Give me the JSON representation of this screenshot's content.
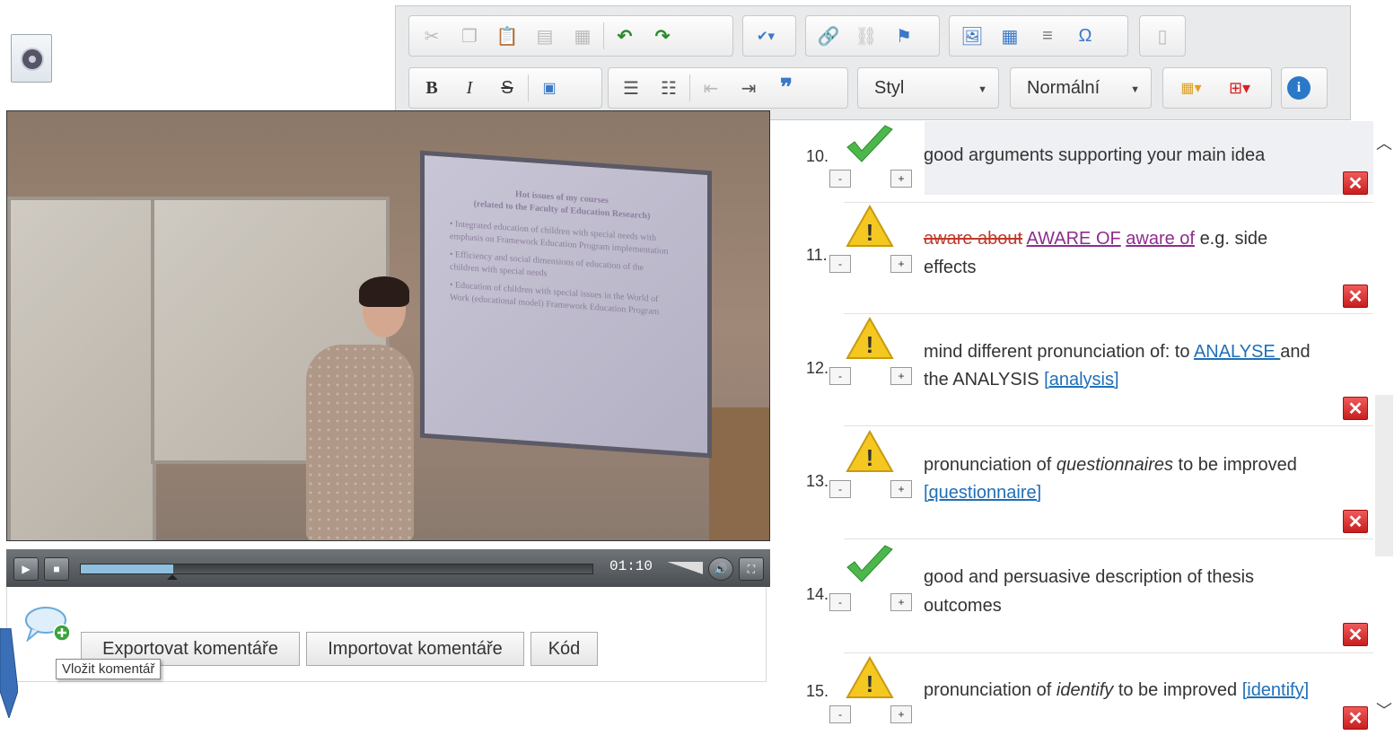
{
  "toolbar": {
    "row1": [
      "cut-icon",
      "copy-icon",
      "paste-icon",
      "paste-text-icon",
      "paste-word-icon",
      "undo-icon",
      "redo-icon",
      "spellcheck-icon",
      "link-icon",
      "unlink-icon",
      "anchor-icon",
      "image-icon",
      "table-icon",
      "horizontal-rule-icon",
      "special-char-icon",
      "page-icon"
    ],
    "bold": "B",
    "italic": "I",
    "strike": "S",
    "style_label": "Styl",
    "format_label": "Normální"
  },
  "video": {
    "time": "01:10",
    "progress": 0.18,
    "slide_lines": [
      "Hot issues of my courses",
      "(related to the Faculty of Education Research)",
      "• Integrated education of children with special needs with emphasis on Framework Education Program implementation",
      "• Efficiency and social dimensions of education of the children with special needs",
      "• Education of children with special issues in the World of Work (educational model) Framework Education Program"
    ]
  },
  "panel": {
    "export_label": "Exportovat komentáře",
    "import_label": "Importovat komentáře",
    "code_label": "Kód",
    "tooltip": "Vložit komentář"
  },
  "comments": [
    {
      "num": "10.",
      "status": "check",
      "line1": "good arguments supporting your main idea",
      "line2": ""
    },
    {
      "num": "11.",
      "status": "warning",
      "strike": "aware about",
      "caps": "AWARE OF",
      "lower": "aware of",
      "tail": "e.g. side",
      "line2": "effects"
    },
    {
      "num": "12.",
      "status": "warning",
      "line1": "mind different pronunciation of:  to ",
      "link1": "ANALYSE ",
      "after1": "and",
      "line2a": "the ANALYSIS ",
      "link2": "[analysis]"
    },
    {
      "num": "13.",
      "status": "warning",
      "line1a": "pronunciation of ",
      "italic": "questionnaires",
      "line1b": " to be improved",
      "link2": "[questionnaire]"
    },
    {
      "num": "14.",
      "status": "check",
      "line1": "good and persuasive description of thesis",
      "line2": "outcomes"
    },
    {
      "num": "15.",
      "status": "warning",
      "line1a": "pronunciation of ",
      "italic": "identify",
      "line1b": " to be improved ",
      "link": "[identify]"
    }
  ],
  "colors": {
    "check": "#3cae3c",
    "warning": "#f2c318",
    "delete": "#d62a2a",
    "link": "#1f6fb8"
  }
}
